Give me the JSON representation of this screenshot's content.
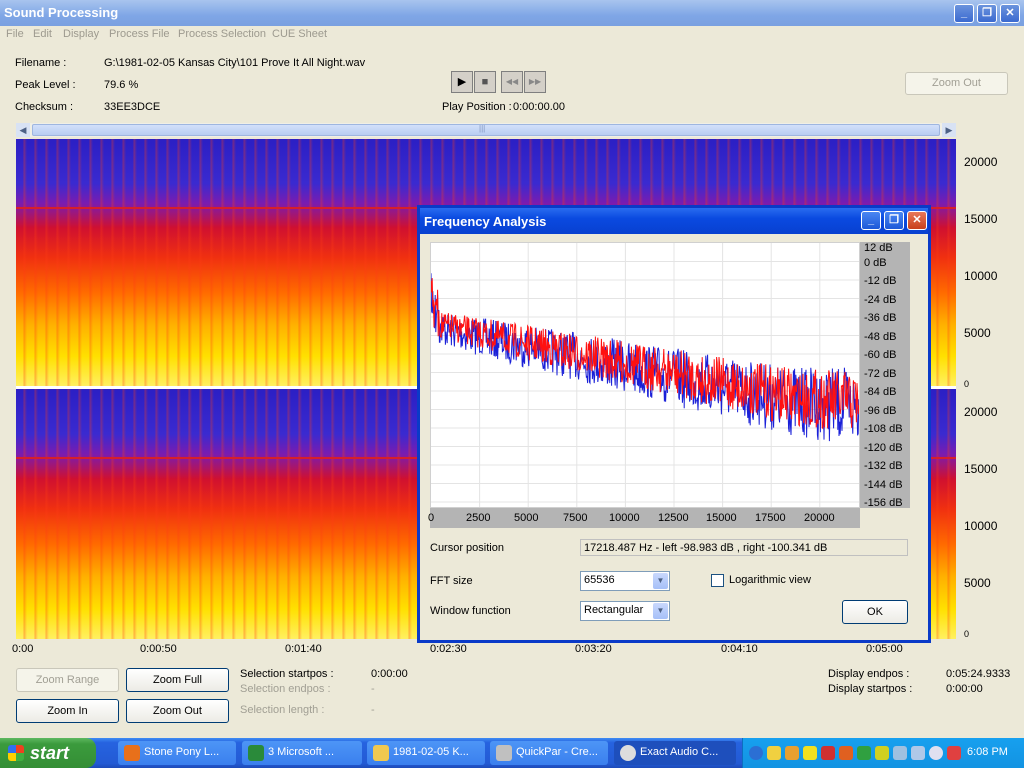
{
  "main_window": {
    "title": "Sound Processing",
    "min_label": "_",
    "max_label": "❐",
    "close_label": "✕"
  },
  "menu": [
    "File",
    "Edit",
    "Display",
    "Process File",
    "Process Selection",
    "CUE Sheet"
  ],
  "info": {
    "filename_label": "Filename :",
    "filename_value": "G:\\1981-02-05 Kansas City\\101 Prove It All Night.wav",
    "peak_label": "Peak Level :",
    "peak_value": "79.6 %",
    "checksum_label": "Checksum :",
    "checksum_value": "33EE3DCE",
    "play_position_label": "Play Position :",
    "play_position_value": "0:00:00.00"
  },
  "transport": {
    "play": "▶",
    "stop": "■",
    "rewind": "◀◀",
    "forward": "▶▶"
  },
  "top_zoom_out": "Zoom Out",
  "scroll": {
    "left": "◀",
    "right": "▶",
    "grip": "|||"
  },
  "spectrogram": {
    "freq_labels_top": [
      "20000",
      "15000",
      "10000",
      "5000",
      "0"
    ],
    "freq_labels_bottom": [
      "20000",
      "15000",
      "10000",
      "5000",
      "0"
    ],
    "time_labels": [
      "0:00",
      "0:00:50",
      "0:01:40",
      "0:02:30",
      "0:03:20",
      "0:04:10",
      "0:05:00"
    ]
  },
  "dialog": {
    "title": "Frequency Analysis",
    "db_labels": [
      "12 dB",
      "0 dB",
      "-12 dB",
      "-24 dB",
      "-36 dB",
      "-48 dB",
      "-60 dB",
      "-72 dB",
      "-84 dB",
      "-96 dB",
      "-108 dB",
      "-120 dB",
      "-132 dB",
      "-144 dB",
      "-156 dB"
    ],
    "x_labels": [
      "0",
      "2500",
      "5000",
      "7500",
      "10000",
      "12500",
      "15000",
      "17500",
      "20000"
    ],
    "cursor_label": "Cursor position",
    "cursor_value": "17218.487 Hz  -  left -98.983 dB , right -100.341 dB",
    "fft_label": "FFT size",
    "fft_value": "65536",
    "log_label": "Logarithmic view",
    "window_label": "Window function",
    "window_value": "Rectangular",
    "ok": "OK"
  },
  "bottom": {
    "zoom_range": "Zoom Range",
    "zoom_full": "Zoom Full",
    "zoom_in": "Zoom In",
    "zoom_out": "Zoom Out",
    "sel_start_label": "Selection startpos :",
    "sel_start_value": "0:00:00",
    "sel_end_label": "Selection endpos :",
    "sel_end_value": "-",
    "sel_len_label": "Selection length :",
    "sel_len_value": "-",
    "disp_end_label": "Display endpos :",
    "disp_end_value": "0:05:24.9333",
    "disp_start_label": "Display startpos :",
    "disp_start_value": "0:00:00"
  },
  "taskbar": {
    "start": "start",
    "tasks": [
      "Stone Pony L...",
      "3 Microsoft ...",
      "1981-02-05 K...",
      "QuickPar - Cre...",
      "Exact Audio C..."
    ],
    "clock": "6:08 PM"
  },
  "colors": {
    "left_channel": "#1a20d8",
    "right_channel": "#ff1010",
    "title_blue": "#0a4ae0"
  }
}
